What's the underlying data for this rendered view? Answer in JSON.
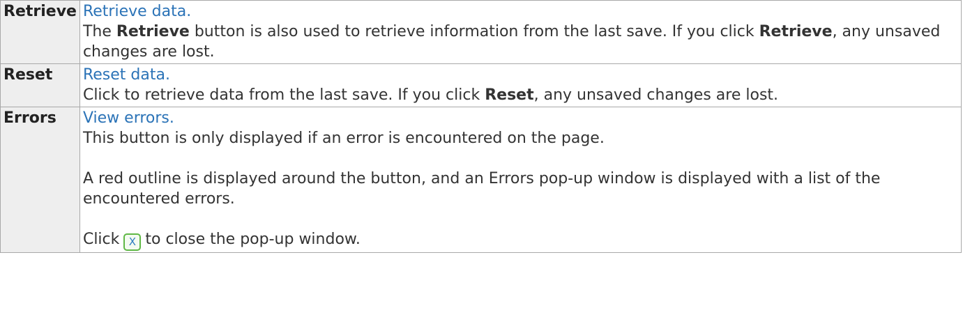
{
  "rows": [
    {
      "label": "Retrieve",
      "link": "Retrieve data.",
      "p1_a": "The ",
      "p1_b": "Retrieve",
      "p1_c": " button is also used to retrieve information from the last save. If you click ",
      "p1_d": "Retrieve",
      "p1_e": ", any unsaved changes are lost."
    },
    {
      "label": "Reset",
      "link": "Reset data.",
      "p1_a": "Click to retrieve data from the last save. If you click ",
      "p1_b": "Reset",
      "p1_c": ", any unsaved changes are lost."
    },
    {
      "label": "Errors",
      "link": "View errors.",
      "p1": "This button is only displayed if an error is encountered on the page.",
      "p2": "A red outline is displayed around the button, and an Errors pop-up window is displayed with a list of the encountered errors.",
      "p3_a": "Click",
      "p3_icon": "X",
      "p3_b": "to close the pop-up window."
    }
  ],
  "icons": {
    "close": "close-icon"
  },
  "colors": {
    "link": "#2b73b7",
    "label_bg": "#eeeeee",
    "border": "#a8a8a8",
    "icon_border": "#5fb845"
  }
}
